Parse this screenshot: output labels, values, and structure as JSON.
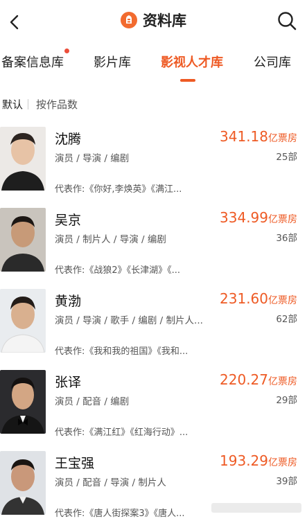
{
  "header": {
    "title": "资料库"
  },
  "tabs": [
    {
      "label": "备案信息库",
      "has_dot": true
    },
    {
      "label": "影片库"
    },
    {
      "label": "影视人才库",
      "active": true
    },
    {
      "label": "公司库"
    }
  ],
  "sort": {
    "default_label": "默认",
    "by_works_label": "按作品数"
  },
  "people": [
    {
      "name": "沈腾",
      "roles": "演员 / 导演 / 编剧",
      "gross": "341.18",
      "gross_unit": "亿票房",
      "count": "25部",
      "works": "代表作:《你好,李焕英》《满江..."
    },
    {
      "name": "吴京",
      "roles": "演员 / 制片人 / 导演 / 编剧",
      "gross": "334.99",
      "gross_unit": "亿票房",
      "count": "36部",
      "works": "代表作:《战狼2》《长津湖》《..."
    },
    {
      "name": "黄渤",
      "roles": "演员 / 导演 / 歌手 / 编剧 / 制片人...",
      "gross": "231.60",
      "gross_unit": "亿票房",
      "count": "62部",
      "works": "代表作:《我和我的祖国》《我和..."
    },
    {
      "name": "张译",
      "roles": "演员 / 配音 / 编剧",
      "gross": "220.27",
      "gross_unit": "亿票房",
      "count": "29部",
      "works": "代表作:《满江红》《红海行动》..."
    },
    {
      "name": "王宝强",
      "roles": "演员 / 配音 / 导演 / 制片人",
      "gross": "193.29",
      "gross_unit": "亿票房",
      "count": "39部",
      "works": "代表作:《唐人街探案3》《唐人..."
    }
  ],
  "colors": {
    "accent": "#ee5a24",
    "badge_dot": "#ec4e3a"
  }
}
